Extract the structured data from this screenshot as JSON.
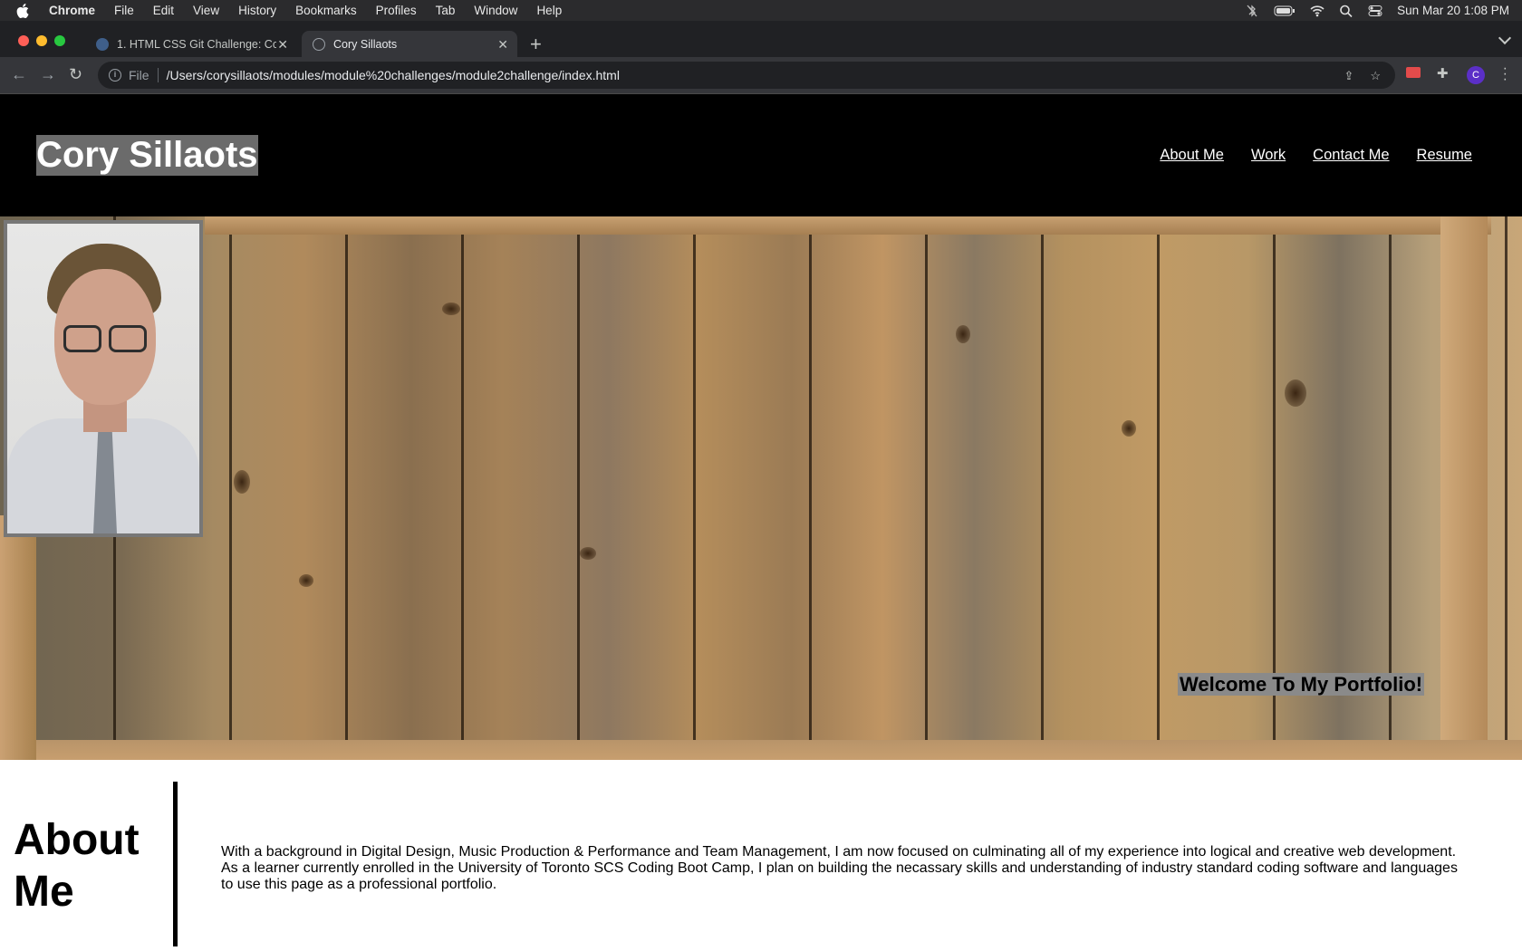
{
  "menubar": {
    "app": "Chrome",
    "items": [
      "File",
      "Edit",
      "View",
      "History",
      "Bookmarks",
      "Profiles",
      "Tab",
      "Window",
      "Help"
    ],
    "clock": "Sun Mar 20  1:08 PM"
  },
  "tabs": [
    {
      "title": "1. HTML CSS Git Challenge: Co",
      "active": false
    },
    {
      "title": "Cory Sillaots",
      "active": true
    }
  ],
  "toolbar": {
    "scheme": "File",
    "url": "/Users/corysillaots/modules/module%20challenges/module2challenge/index.html",
    "profile_initial": "C"
  },
  "site": {
    "name": "Cory Sillaots",
    "nav": [
      "About Me",
      "Work",
      "Contact Me",
      "Resume"
    ],
    "welcome": "Welcome To My Portfolio!",
    "about_title": "About Me",
    "about_text": "With a background in Digital Design, Music Production & Performance and Team Management, I am now focused on culminating all of my experience into logical and creative web development. As a learner currently enrolled in the University of Toronto SCS Coding Boot Camp, I plan on building the necassary skills and understanding of industry standard coding software and languages to use this page as a professional portfolio."
  },
  "colors": {
    "header_bg": "#000000",
    "name_highlight": "#6b6b6b",
    "welcome_highlight": "#8a8a8a",
    "profile_avatar": "#5b2fc7"
  }
}
